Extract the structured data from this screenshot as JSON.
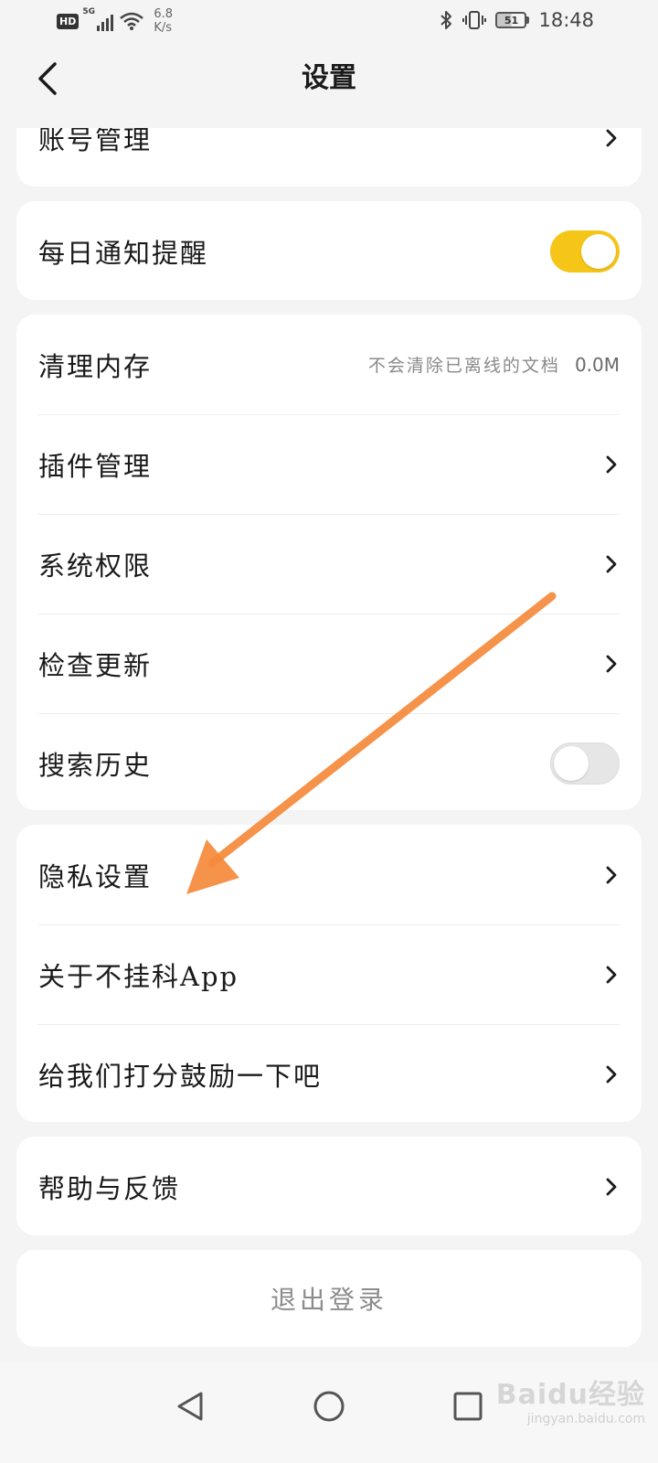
{
  "status_bar": {
    "hd_label": "HD",
    "network_label": "5G",
    "speed_value": "6.8",
    "speed_unit": "K/s",
    "battery_level": "51",
    "time": "18:48"
  },
  "header": {
    "title": "设置"
  },
  "cards": {
    "account": {
      "label": "账号管理"
    },
    "notify": {
      "label": "每日通知提醒",
      "toggle_on": true
    },
    "general": {
      "clear_cache_label": "清理内存",
      "clear_cache_hint": "不会清除已离线的文档",
      "clear_cache_value": "0.0M",
      "plugins_label": "插件管理",
      "permissions_label": "系统权限",
      "update_label": "检查更新",
      "search_history_label": "搜索历史",
      "search_history_toggle_on": false
    },
    "about": {
      "privacy_label": "隐私设置",
      "about_app_label": "关于不挂科App",
      "rate_label": "给我们打分鼓励一下吧"
    },
    "help": {
      "label": "帮助与反馈"
    },
    "logout": {
      "label": "退出登录"
    }
  },
  "annotation": {
    "arrow_color": "#f58a3c"
  },
  "colors": {
    "accent": "#f5c518",
    "background": "#f4f4f4"
  },
  "watermark": {
    "brand": "Baidu经验",
    "sub": "jingyan.baidu.com"
  }
}
